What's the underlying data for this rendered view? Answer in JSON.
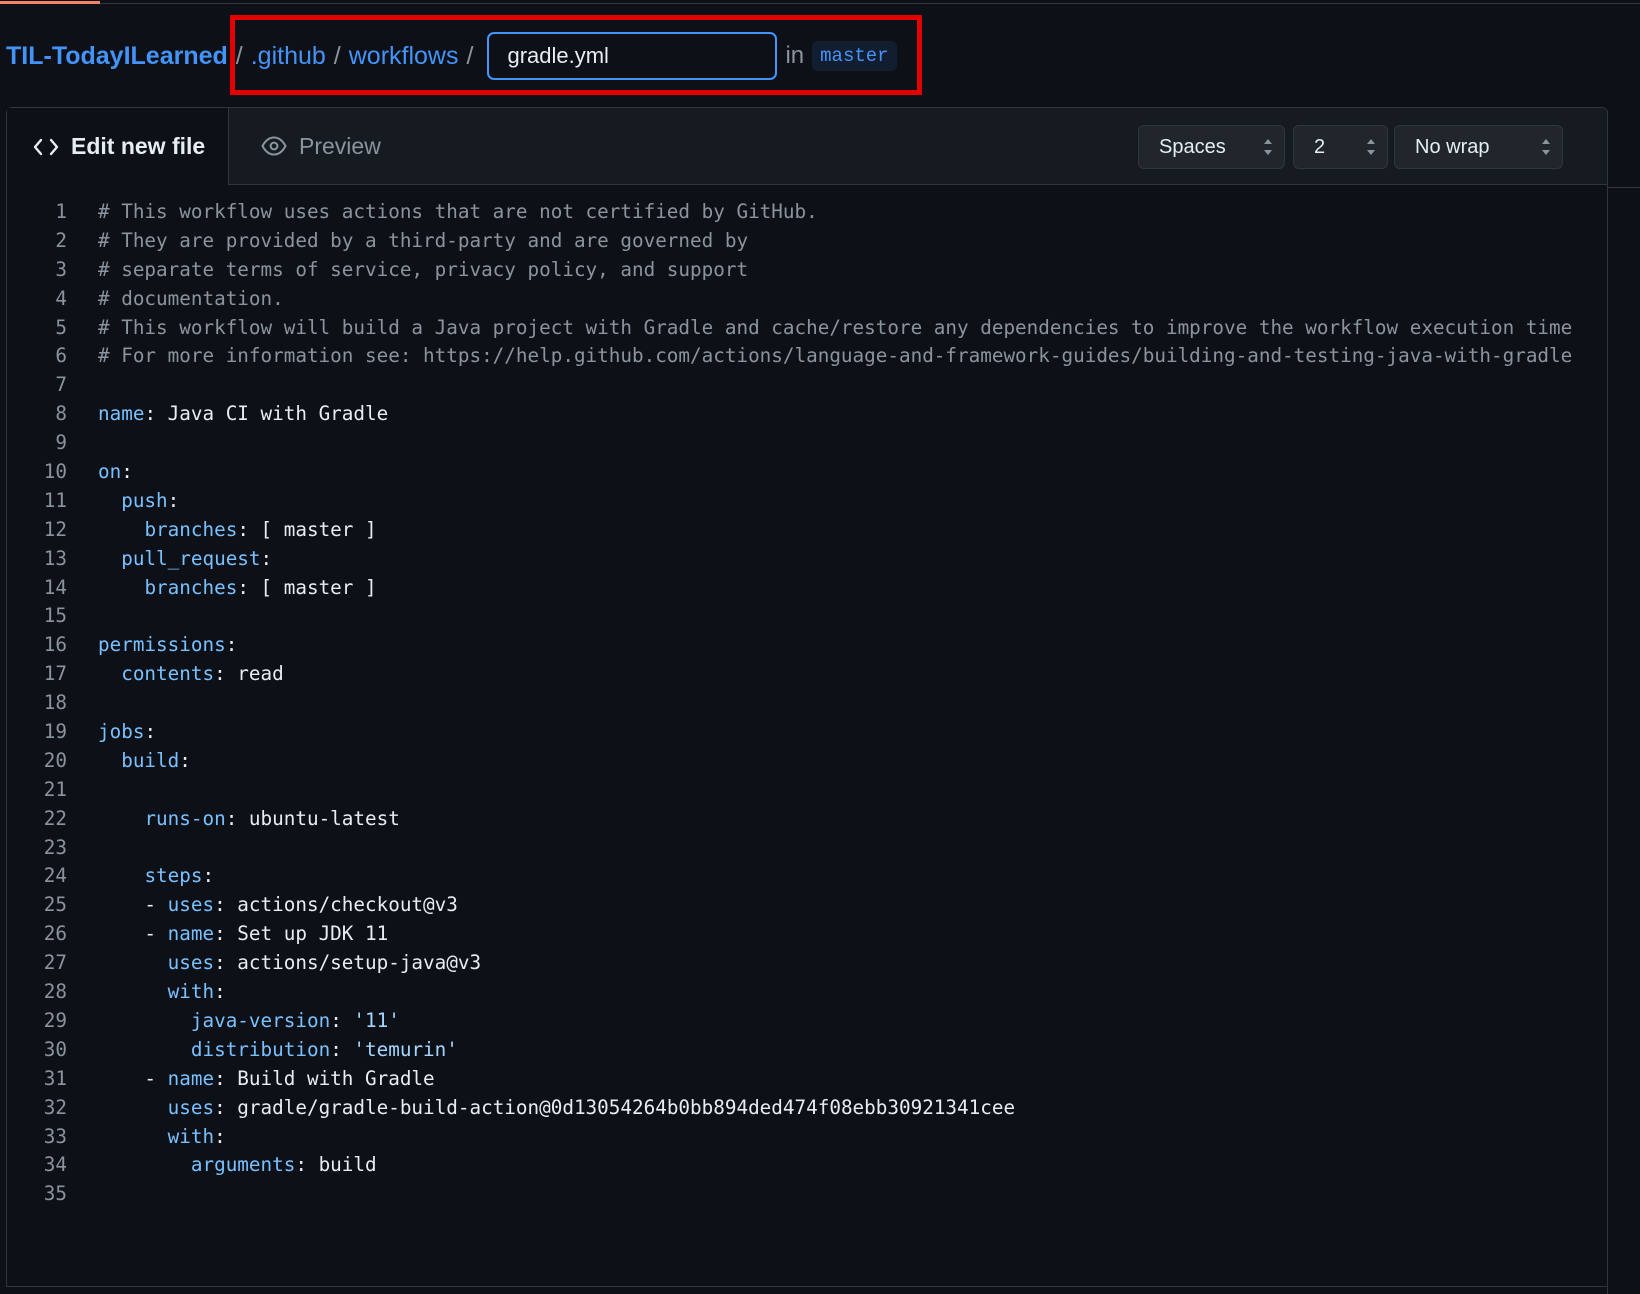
{
  "breadcrumb": {
    "repo": "TIL-TodayILearned",
    "sep": "/",
    "dir1": ".github",
    "dir2": "workflows",
    "filename": "gradle.yml",
    "in_label": "in",
    "branch": "master"
  },
  "editor": {
    "tab_edit": "Edit new file",
    "tab_preview": "Preview",
    "indent_mode": "Spaces",
    "indent_size": "2",
    "wrap_mode": "No wrap"
  },
  "code_lines": [
    "# This workflow uses actions that are not certified by GitHub.",
    "# They are provided by a third-party and are governed by",
    "# separate terms of service, privacy policy, and support",
    "# documentation.",
    "# This workflow will build a Java project with Gradle and cache/restore any dependencies to improve the workflow execution time",
    "# For more information see: https://help.github.com/actions/language-and-framework-guides/building-and-testing-java-with-gradle",
    "",
    "name: Java CI with Gradle",
    "",
    "on:",
    "  push:",
    "    branches: [ master ]",
    "  pull_request:",
    "    branches: [ master ]",
    "",
    "permissions:",
    "  contents: read",
    "",
    "jobs:",
    "  build:",
    "",
    "    runs-on: ubuntu-latest",
    "",
    "    steps:",
    "    - uses: actions/checkout@v3",
    "    - name: Set up JDK 11",
    "      uses: actions/setup-java@v3",
    "      with:",
    "        java-version: '11'",
    "        distribution: 'temurin'",
    "    - name: Build with Gradle",
    "      uses: gradle/gradle-build-action@0d13054264b0bb894ded474f08ebb30921341cee",
    "      with:",
    "        arguments: build",
    ""
  ],
  "colors": {
    "background": "#0d1117",
    "link": "#4493f8",
    "highlight": "#e30000",
    "yaml_key": "#79c0ff",
    "comment": "#8b949e"
  }
}
